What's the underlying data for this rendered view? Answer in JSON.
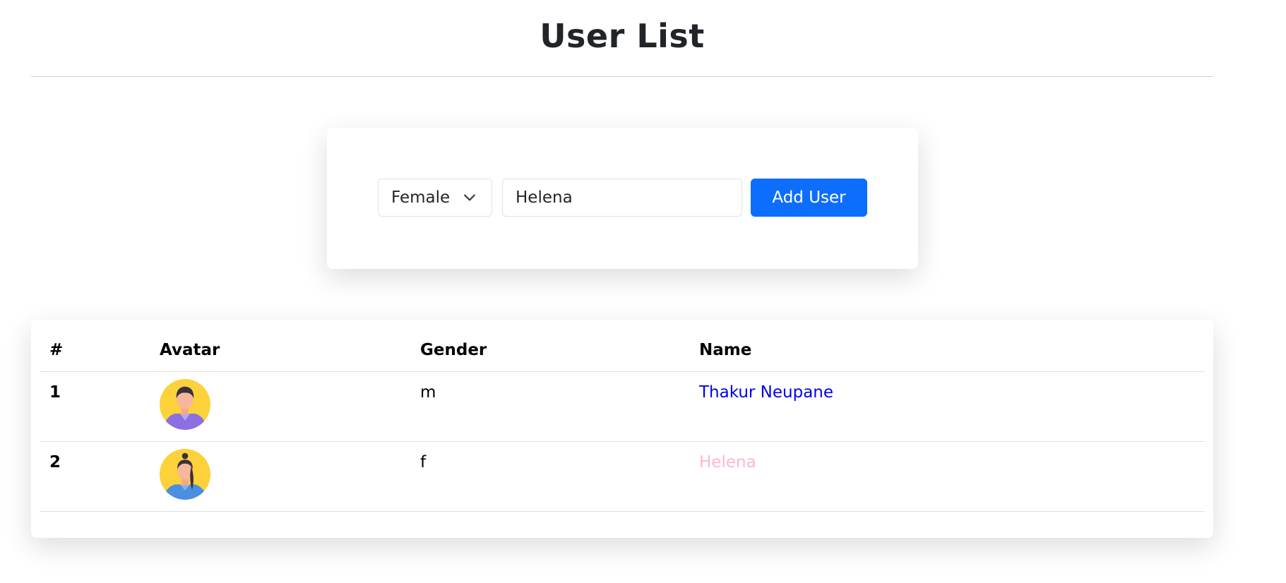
{
  "page": {
    "title": "User List"
  },
  "form": {
    "gender_selected": "Female",
    "name_value": "Helena",
    "add_button_label": "Add User"
  },
  "table": {
    "headers": {
      "index": "#",
      "avatar": "Avatar",
      "gender": "Gender",
      "name": "Name"
    },
    "rows": [
      {
        "index": "1",
        "gender": "m",
        "name": "Thakur Neupane",
        "name_color": "#0000ee",
        "avatar_icon": "male-avatar-icon"
      },
      {
        "index": "2",
        "gender": "f",
        "name": "Helena",
        "name_color": "#ffb6c8",
        "avatar_icon": "female-avatar-icon"
      }
    ]
  },
  "colors": {
    "primary_button": "#0d6efd",
    "avatar_background": "#fdd13a"
  }
}
